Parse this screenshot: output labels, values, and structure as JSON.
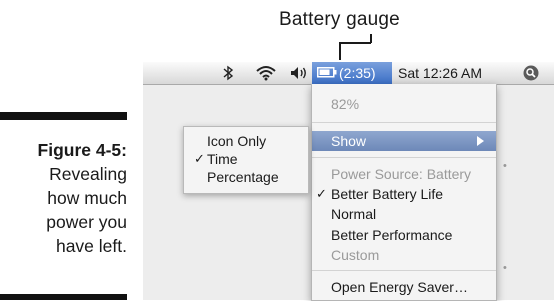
{
  "callout": {
    "label": "Battery gauge"
  },
  "caption": {
    "figure": "Figure 4-5:",
    "lines": [
      "Revealing",
      "how much",
      "power you",
      "have left."
    ]
  },
  "menubar": {
    "icons": [
      "bluetooth-icon",
      "wifi-icon",
      "volume-icon",
      "battery-icon",
      "spotlight-icon"
    ],
    "battery_time": "(2:35)",
    "clock": "Sat 12:26 AM"
  },
  "battery_menu": {
    "charge_percent": "82%",
    "show_label": "Show",
    "power_source": "Power Source: Battery",
    "options": [
      "Better Battery Life",
      "Normal",
      "Better Performance",
      "Custom"
    ],
    "checked_option": "Better Battery Life",
    "open_energy_saver": "Open Energy Saver…",
    "accent_color": "#6d88b8"
  },
  "show_submenu": {
    "items": [
      "Icon Only",
      "Time",
      "Percentage"
    ],
    "checked_item": "Time"
  }
}
